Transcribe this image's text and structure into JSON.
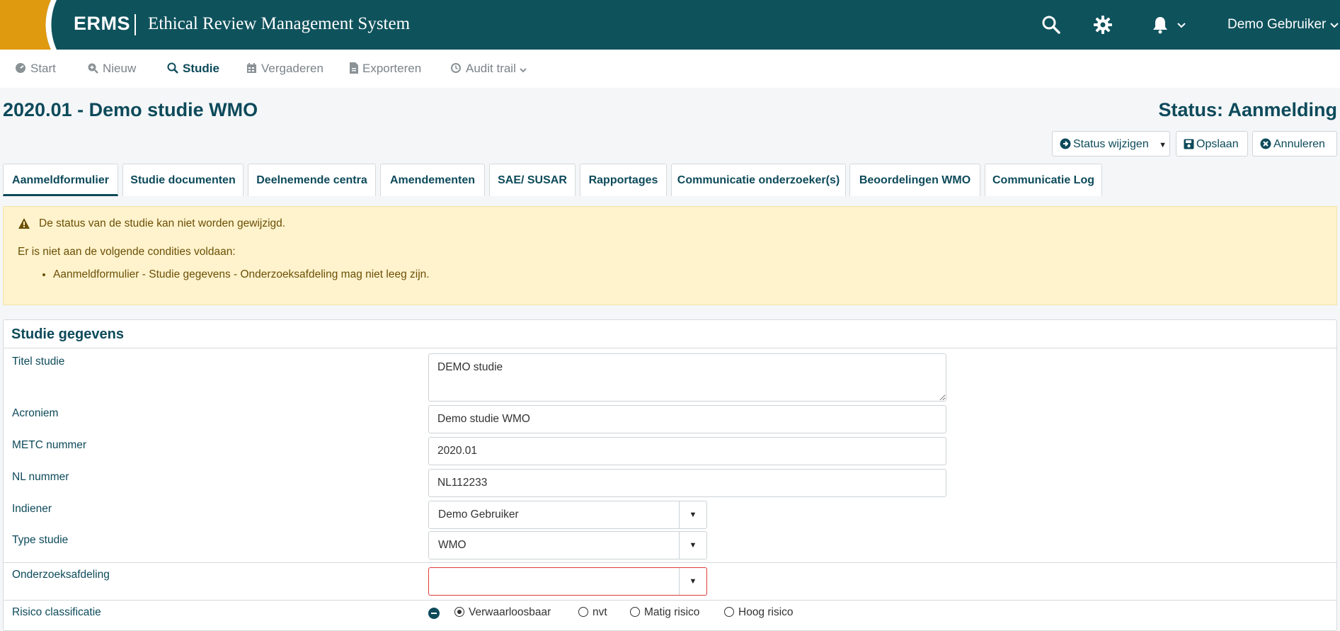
{
  "header": {
    "brand": "ERMS",
    "subtitle": "Ethical Review Management System",
    "user": "Demo Gebruiker",
    "icons": [
      "search-icon",
      "gear-icon",
      "bell-icon"
    ],
    "colors": {
      "header_bg": "#0e525c",
      "logo_accent": "#e09a0f"
    }
  },
  "nav": {
    "items": [
      {
        "label": "Start",
        "icon": "dashboard-icon"
      },
      {
        "label": "Nieuw",
        "icon": "search-plus-icon"
      },
      {
        "label": "Studie",
        "icon": "search-icon"
      },
      {
        "label": "Vergaderen",
        "icon": "calendar-icon"
      },
      {
        "label": "Exporteren",
        "icon": "file-export-icon"
      },
      {
        "label": "Audit trail",
        "icon": "history-icon"
      }
    ],
    "active": "Studie"
  },
  "page": {
    "title": "2020.01 - Demo studie WMO",
    "status": "Status: Aanmelding"
  },
  "actions": {
    "status_change": "Status wijzigen",
    "save": "Opslaan",
    "cancel": "Annuleren"
  },
  "tabs": [
    "Aanmeldformulier",
    "Studie documenten",
    "Deelnemende centra",
    "Amendementen",
    "SAE/ SUSAR",
    "Rapportages",
    "Communicatie onderzoeker(s)",
    "Beoordelingen WMO",
    "Communicatie Log"
  ],
  "alert": {
    "title": "De status van de studie kan niet worden gewijzigd.",
    "intro": "Er is niet aan de volgende condities voldaan:",
    "conditions": [
      "Aanmeldformulier - Studie gegevens - Onderzoeksafdeling mag niet leeg zijn."
    ]
  },
  "form": {
    "section_title": "Studie gegevens",
    "fields": {
      "titel": {
        "label": "Titel studie",
        "value": "DEMO studie"
      },
      "acroniem": {
        "label": "Acroniem",
        "value": "Demo studie WMO"
      },
      "metc": {
        "label": "METC nummer",
        "value": "2020.01"
      },
      "nl": {
        "label": "NL nummer",
        "value": "NL112233"
      },
      "indiener": {
        "label": "Indiener",
        "value": "Demo Gebruiker"
      },
      "type": {
        "label": "Type studie",
        "value": "WMO"
      },
      "afdeling": {
        "label": "Onderzoeksafdeling",
        "value": ""
      },
      "risico": {
        "label": "Risico classificatie",
        "options": [
          "Verwaarloosbaar",
          "nvt",
          "Matig risico",
          "Hoog risico"
        ],
        "selected": "Verwaarloosbaar"
      }
    }
  }
}
